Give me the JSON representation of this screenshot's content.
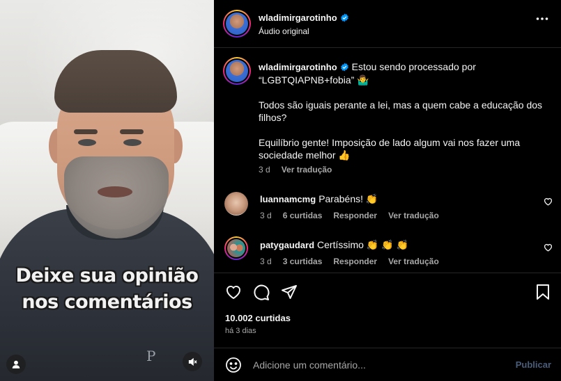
{
  "video": {
    "caption_line1": "Deixe sua opinião",
    "caption_line2": "nos comentários",
    "shirt_logo": "P"
  },
  "header": {
    "username": "wladimirgarotinho",
    "audio": "Áudio original",
    "more_icon": "more-horizontal-icon"
  },
  "post": {
    "username": "wladimirgarotinho",
    "text_p1": "Estou sendo processado por “LGBTQIAPNB+fobia” 🤷‍♂️",
    "text_p2": "Todos são iguais perante a lei, mas a quem cabe a educação dos filhos?",
    "text_p3": "Equilíbrio gente! Imposição de lado algum vai nos fazer uma sociedade melhor 👍",
    "time": "3 d",
    "translate": "Ver tradução"
  },
  "comments": [
    {
      "username": "luannamcmg",
      "text": "Parabéns! 👏",
      "time": "3 d",
      "likes": "6 curtidas",
      "reply": "Responder",
      "translate": "Ver tradução"
    },
    {
      "username": "patygaudard",
      "text": "Certíssimo 👏 👏 👏",
      "time": "3 d",
      "likes": "3 curtidas",
      "reply": "Responder",
      "translate": "Ver tradução"
    }
  ],
  "actions": {
    "likes": "10.002 curtidas",
    "ago": "há 3 dias"
  },
  "composer": {
    "placeholder": "Adicione um comentário...",
    "publish": "Publicar"
  },
  "colors": {
    "background": "#000000",
    "text": "#f5f5f5",
    "secondary": "#a8a8a8",
    "verified": "#0095f6",
    "publish_disabled": "#4a5d7a"
  }
}
